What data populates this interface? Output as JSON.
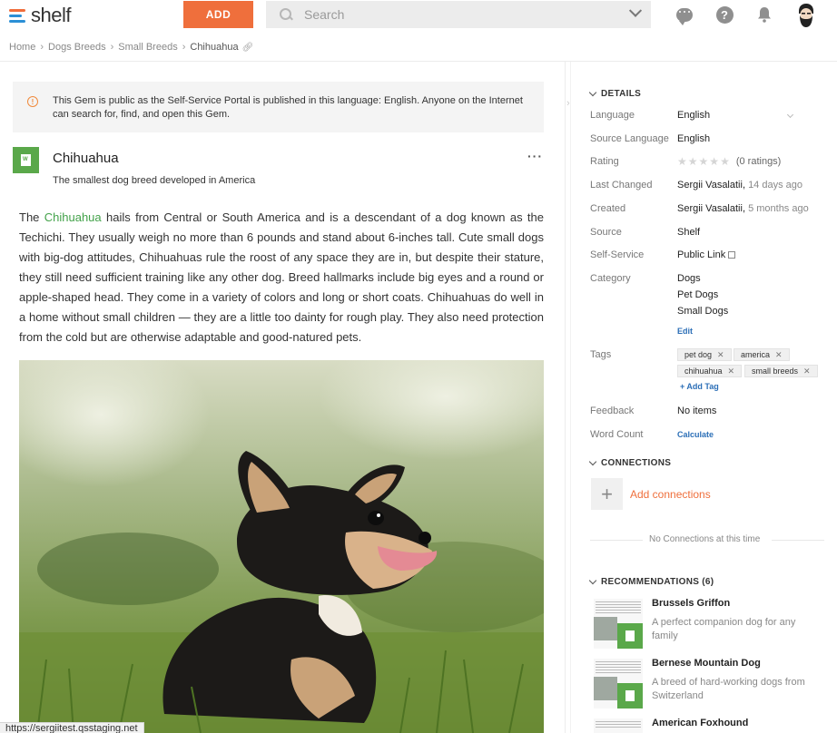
{
  "header": {
    "logo_text": "shelf",
    "add_label": "ADD",
    "search_placeholder": "Search"
  },
  "breadcrumb": [
    "Home",
    "Dogs Breeds",
    "Small Breeds",
    "Chihuahua"
  ],
  "notice": {
    "text": "This Gem is public as the Self-Service Portal is published in this language: English. Anyone on the Internet can search for, find, and open this Gem."
  },
  "gem": {
    "title": "Chihuahua",
    "subtitle": "The smallest dog breed developed in America",
    "more": "···",
    "body_link": "Chihuahua",
    "body_pre": "The ",
    "body_post": " hails from Central or South America and is a descendant of a dog known as the Techichi. They usually weigh no more than 6 pounds and stand about 6-inches tall. Cute small dogs with big-dog attitudes, Chihuahuas rule the roost of any space they are in, but despite their stature, they still need sufficient training like any other dog. Breed hallmarks include big eyes and a round or apple-shaped head. They come in a variety of colors and long or short coats. Chihuahuas do well in a home without small children — they are a little too dainty for rough play. They also need protection from the cold but are otherwise adaptable and good-natured pets."
  },
  "status_url": "https://sergiitest.qsstaging.net",
  "details": {
    "heading": "DETAILS",
    "language_label": "Language",
    "language_value": "English",
    "source_language_label": "Source Language",
    "source_language_value": "English",
    "rating_label": "Rating",
    "rating_count": "(0 ratings)",
    "last_changed_label": "Last Changed",
    "last_changed_user": "Sergii Vasalatii,",
    "last_changed_when": "14 days ago",
    "created_label": "Created",
    "created_user": "Sergii Vasalatii,",
    "created_when": "5 months ago",
    "source_label": "Source",
    "source_value": "Shelf",
    "self_service_label": "Self-Service",
    "self_service_value": "Public Link",
    "category_label": "Category",
    "categories": [
      "Dogs",
      "Pet Dogs",
      "Small Dogs"
    ],
    "category_edit": "Edit",
    "tags_label": "Tags",
    "tags": [
      "pet dog",
      "america",
      "chihuahua",
      "small breeds"
    ],
    "add_tag": "+ Add Tag",
    "feedback_label": "Feedback",
    "feedback_value": "No items",
    "word_count_label": "Word Count",
    "word_count_action": "Calculate"
  },
  "connections": {
    "heading": "CONNECTIONS",
    "add_label": "Add connections",
    "empty_text": "No Connections at this time"
  },
  "recommendations": {
    "heading": "RECOMMENDATIONS (6)",
    "items": [
      {
        "title": "Brussels Griffon",
        "desc": "A perfect companion dog for any family"
      },
      {
        "title": "Bernese Mountain Dog",
        "desc": "A breed of hard-working dogs from Switzerland"
      },
      {
        "title": "American Foxhound",
        "desc": ""
      }
    ]
  },
  "colors": {
    "accent": "#ef6f3c",
    "gem_green": "#5aa84a",
    "link_blue": "#2c6fb7"
  }
}
